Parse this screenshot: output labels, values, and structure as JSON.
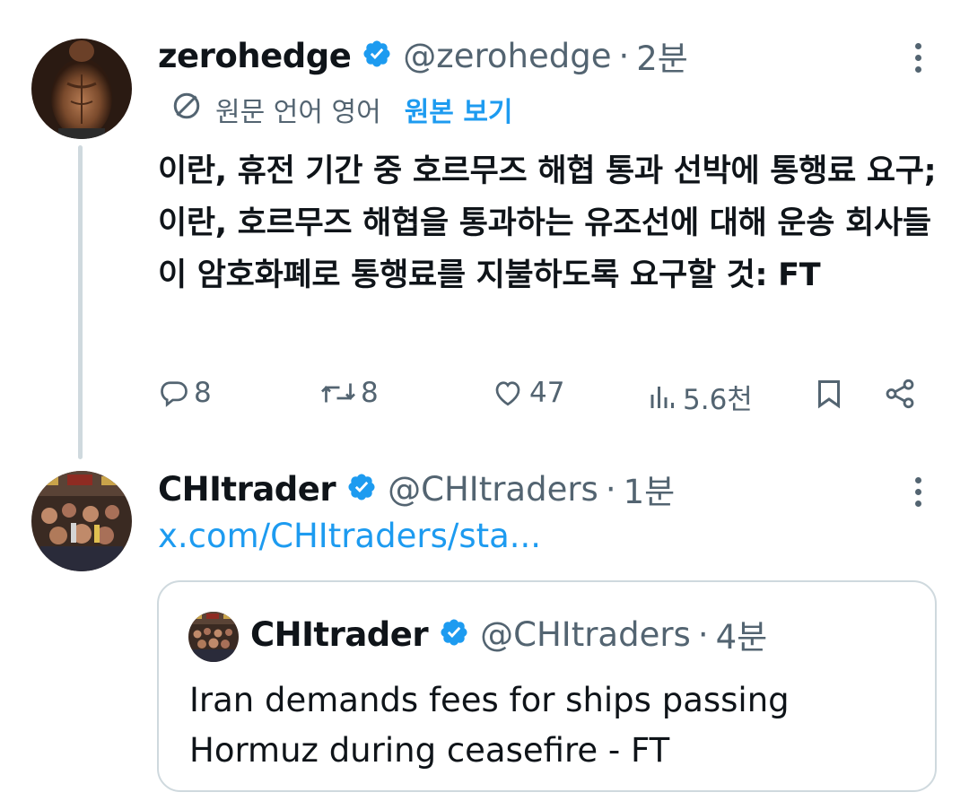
{
  "tweet1": {
    "name": "zerohedge",
    "handle": "@zerohedge",
    "separator": "·",
    "time": "2분",
    "translation": {
      "label": "원문 언어 영어",
      "view_original": "원본 보기"
    },
    "text": "이란, 휴전 기간 중 호르무즈 해협 통과 선박에 통행료 요구; 이란, 호르무즈 해협을 통과하는 유조선에 대해 운송 회사들이 암호화폐로 통행료를 지불하도록 요구할 것: FT",
    "actions": {
      "replies": "8",
      "reposts": "8",
      "likes": "47",
      "views": "5.6천"
    }
  },
  "tweet2": {
    "name": "CHItrader",
    "handle": "@CHItraders",
    "separator": "·",
    "time": "1분",
    "link": "x.com/CHItraders/sta...",
    "quote": {
      "name": "CHItrader",
      "handle": "@CHItraders",
      "separator": "·",
      "time": "4분",
      "text": "Iran demands fees for ships passing Hormuz during ceasefire - FT"
    }
  },
  "colors": {
    "accent": "#1d9bf0",
    "text_primary": "#0f1419",
    "text_secondary": "#536471",
    "border": "#cfd9de"
  },
  "icons": {
    "verified": "verified-badge-icon",
    "translate": "globe-translate-icon",
    "reply": "reply-icon",
    "repost": "repost-icon",
    "like": "heart-icon",
    "views": "views-bar-chart-icon",
    "bookmark": "bookmark-icon",
    "share": "share-icon",
    "more": "more-vertical-icon"
  }
}
